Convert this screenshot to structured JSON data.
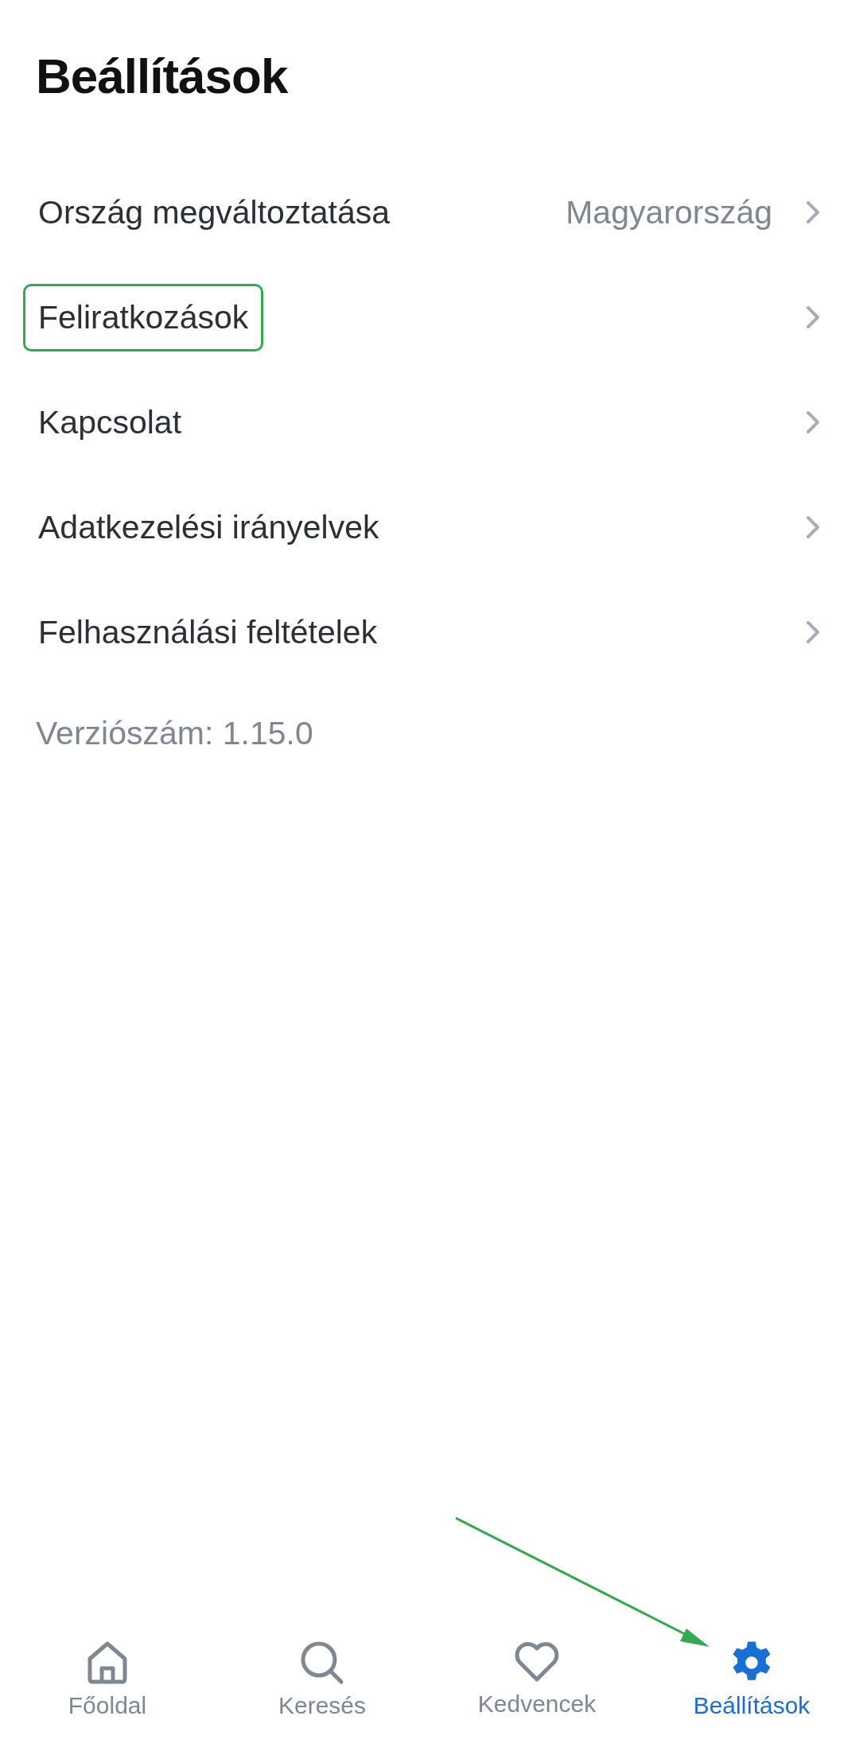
{
  "title": "Beállítások",
  "settings": [
    {
      "label": "Ország megváltoztatása",
      "value": "Magyarország",
      "highlighted": false
    },
    {
      "label": "Feliratkozások",
      "highlighted": true
    },
    {
      "label": "Kapcsolat",
      "highlighted": false
    },
    {
      "label": "Adatkezelési irányelvek",
      "highlighted": false
    },
    {
      "label": "Felhasználási feltételek",
      "highlighted": false
    }
  ],
  "version": "Verziószám: 1.15.0",
  "bottom_nav": [
    {
      "kind": "home",
      "label": "Főoldal",
      "selected": false
    },
    {
      "kind": "search",
      "label": "Keresés",
      "selected": false
    },
    {
      "kind": "heart",
      "label": "Kedvencek",
      "selected": false
    },
    {
      "kind": "gear",
      "label": "Beállítások",
      "selected": true
    }
  ],
  "annotations": [
    {
      "kind": "arrow",
      "color": "#34a853"
    }
  ]
}
